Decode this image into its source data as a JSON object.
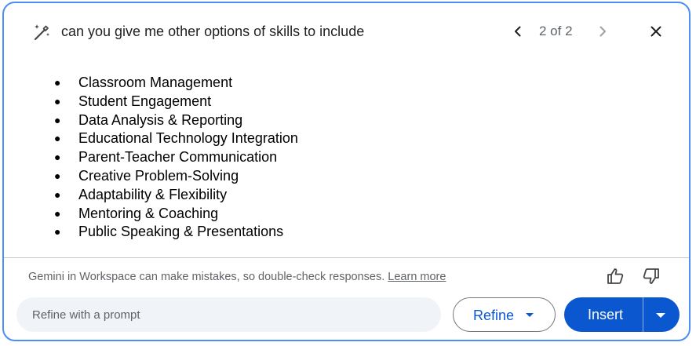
{
  "header": {
    "prompt": "can you give me other options of skills to include",
    "page_indicator": "2 of 2",
    "icons": {
      "prompt_icon": "pen-sparkle-icon",
      "prev": "chevron-left-icon",
      "next": "chevron-right-icon",
      "close": "close-icon"
    }
  },
  "skills": [
    "Classroom Management",
    "Student Engagement",
    "Data Analysis & Reporting",
    "Educational Technology Integration",
    "Parent-Teacher Communication",
    "Creative Problem-Solving",
    "Adaptability & Flexibility",
    "Mentoring & Coaching",
    "Public Speaking & Presentations"
  ],
  "footer": {
    "disclaimer": "Gemini in Workspace can make mistakes, so double-check responses.",
    "learn_more": "Learn more",
    "feedback_icons": [
      "thumb-up-icon",
      "thumb-down-icon"
    ]
  },
  "actions": {
    "refine_placeholder": "Refine with a prompt",
    "refine_value": "",
    "refine_label": "Refine",
    "insert_label": "Insert"
  },
  "colors": {
    "border": "#4c8df6",
    "primary": "#0b57d0",
    "input_bg": "#f0f4f9",
    "muted_text": "#5f6368"
  }
}
